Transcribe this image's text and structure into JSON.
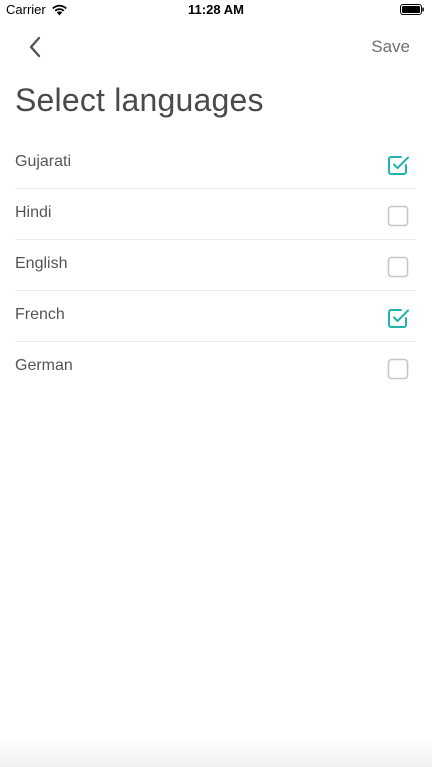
{
  "status_bar": {
    "carrier": "Carrier",
    "time": "11:28 AM"
  },
  "nav": {
    "back_icon": "chevron-left-icon",
    "save_label": "Save"
  },
  "title": "Select languages",
  "colors": {
    "accent": "#1fb5ad",
    "checkbox_border": "#c7c7c7",
    "text": "#555555"
  },
  "languages": [
    {
      "label": "Gujarati",
      "checked": true
    },
    {
      "label": "Hindi",
      "checked": false
    },
    {
      "label": "English",
      "checked": false
    },
    {
      "label": "French",
      "checked": true
    },
    {
      "label": "German",
      "checked": false
    }
  ]
}
